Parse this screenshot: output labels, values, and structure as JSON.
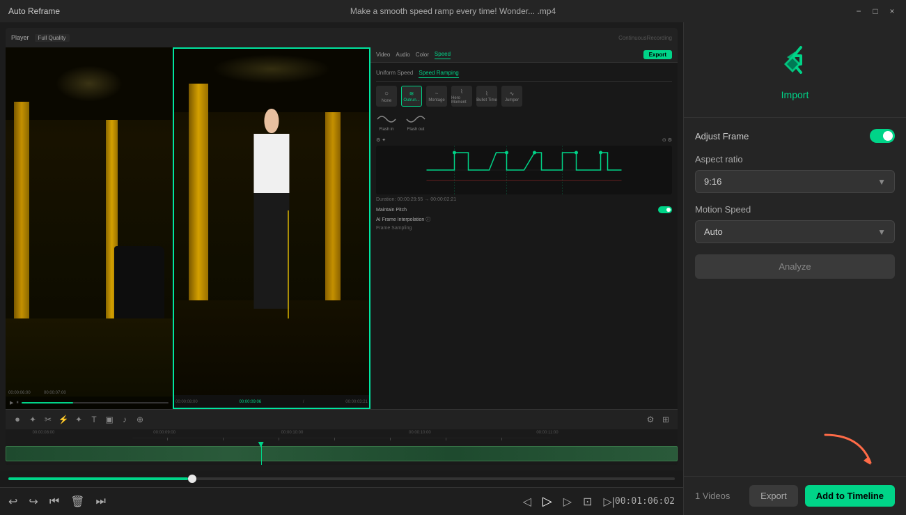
{
  "app": {
    "title": "Auto Reframe",
    "file_title": "Make a smooth speed ramp every time!  Wonder... .mp4"
  },
  "titlebar": {
    "minimize": "−",
    "maximize": "□",
    "close": "×"
  },
  "inner_editor": {
    "player_label": "Player",
    "quality_label": "Full Quality",
    "tabs": [
      "Video",
      "Audio",
      "Color",
      "Speed"
    ],
    "active_tab": "Speed",
    "export_btn": "Export",
    "speed_tabs": [
      "Uniform Speed",
      "Speed Ramping"
    ],
    "active_speed_tab": "Speed Ramping",
    "presets": [
      {
        "name": "None",
        "icon": "○"
      },
      {
        "name": "Outrun...",
        "icon": "≋"
      },
      {
        "name": "Montage",
        "icon": "~"
      },
      {
        "name": "Hero Moment",
        "icon": "⌇"
      },
      {
        "name": "Bullet Time",
        "icon": "⌇"
      },
      {
        "name": "Jumper",
        "icon": "∿"
      }
    ],
    "flash_presets": [
      "Flash in",
      "Flash out"
    ],
    "duration_text": "Duration: 00:00:29:55 → 00:00:02:21",
    "maintain_pitch": "Maintain Pitch",
    "ai_frame": "AI Frame Interpolation ⓘ",
    "frame_sampling": "Frame Sampling"
  },
  "right_panel": {
    "import_label": "Import",
    "adjust_frame_label": "Adjust Frame",
    "aspect_ratio_label": "Aspect ratio",
    "aspect_ratio_value": "9:16",
    "motion_speed_label": "Motion Speed",
    "motion_speed_value": "Auto",
    "analyze_btn": "Analyze",
    "videos_count": "1 Videos",
    "export_btn": "Export",
    "add_timeline_btn": "Add to Timeline"
  },
  "playback": {
    "time_display": "00:01:06:02"
  },
  "progress": {
    "fill_percent": 27
  }
}
